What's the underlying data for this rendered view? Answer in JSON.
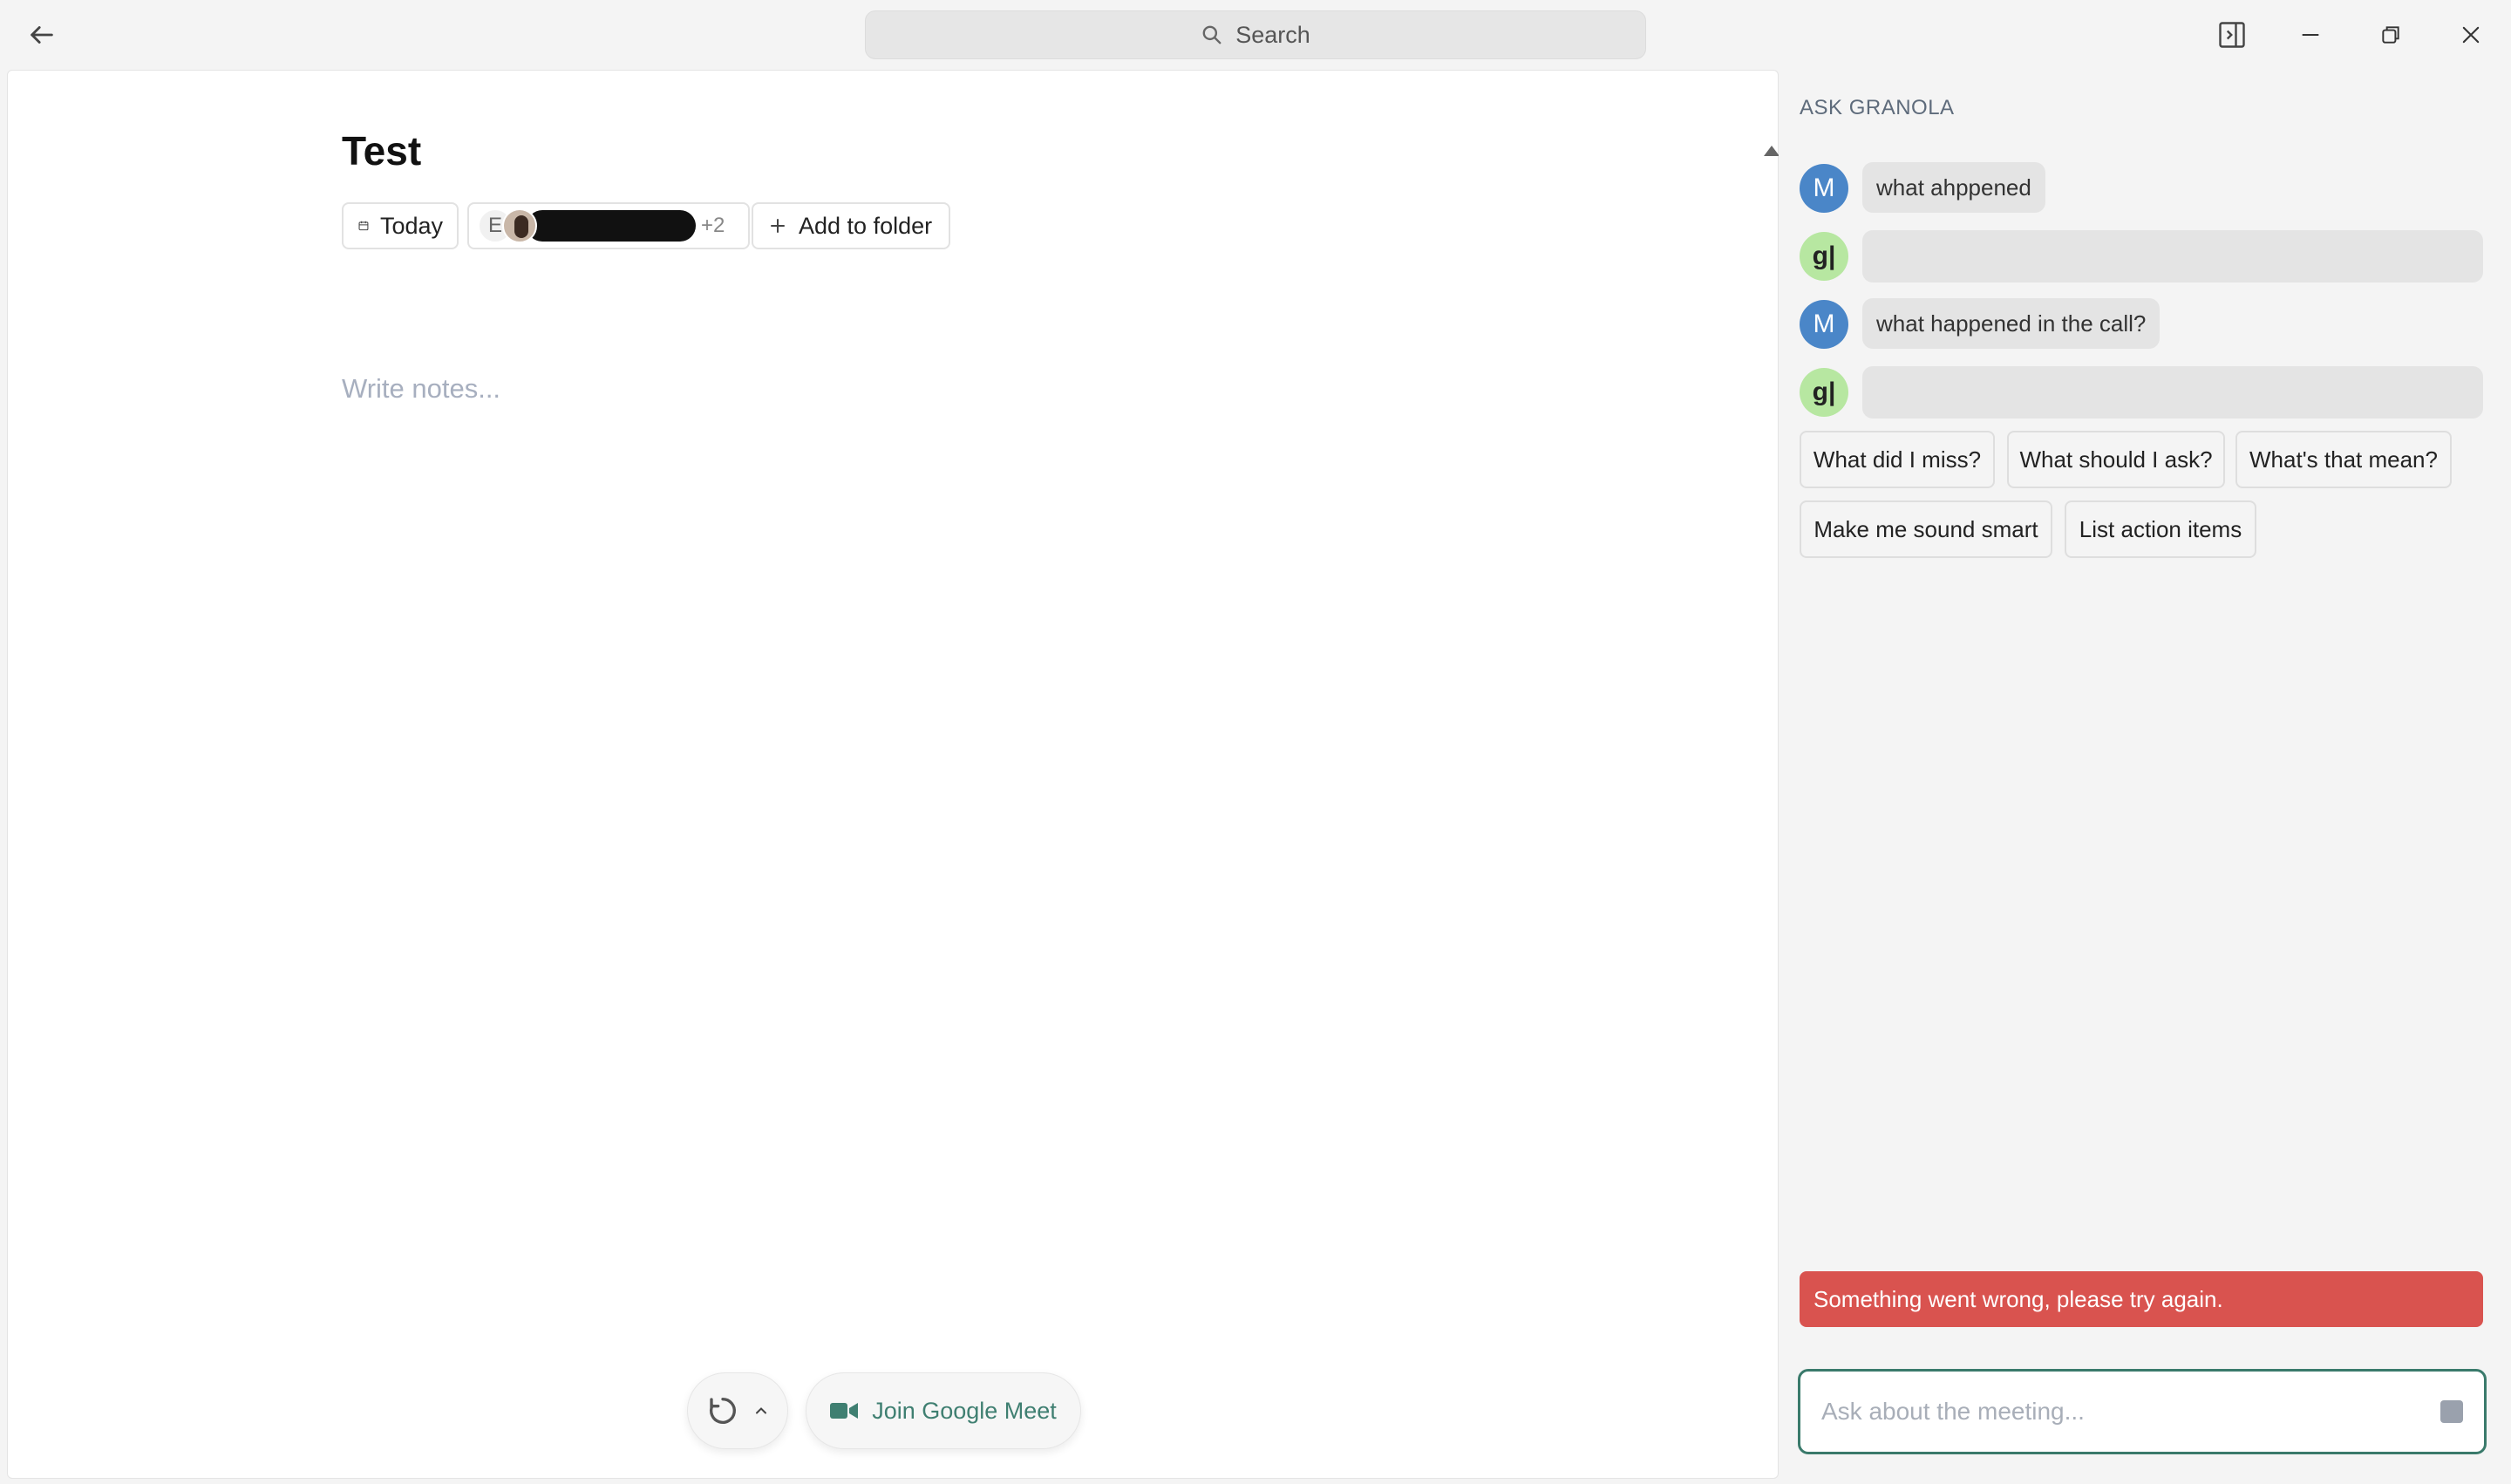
{
  "titlebar": {
    "search_label": "Search"
  },
  "note": {
    "title": "Test",
    "date_chip": "Today",
    "attendee_initial": "E",
    "attendee_more": "+2",
    "add_folder_label": "Add to folder",
    "notes_placeholder": "Write notes..."
  },
  "meeting_controls": {
    "join_label": "Join Google Meet"
  },
  "ask_panel": {
    "heading": "ASK GRANOLA",
    "messages": [
      {
        "role": "user",
        "avatar": "M",
        "text": "what ahppened"
      },
      {
        "role": "assistant",
        "avatar": "g|",
        "text": ""
      },
      {
        "role": "user",
        "avatar": "M",
        "text": "what happened in the call?"
      },
      {
        "role": "assistant",
        "avatar": "g|",
        "text": ""
      }
    ],
    "suggestions": [
      "What did I miss?",
      "What should I ask?",
      "What's that mean?",
      "Make me sound smart",
      "List action items"
    ],
    "error_text": "Something went wrong, please try again.",
    "input_placeholder": "Ask about the meeting..."
  },
  "colors": {
    "user_avatar": "#4a86c8",
    "granola_avatar": "#b7e7a1",
    "error": "#d9534f",
    "accent": "#3a7a6b"
  }
}
